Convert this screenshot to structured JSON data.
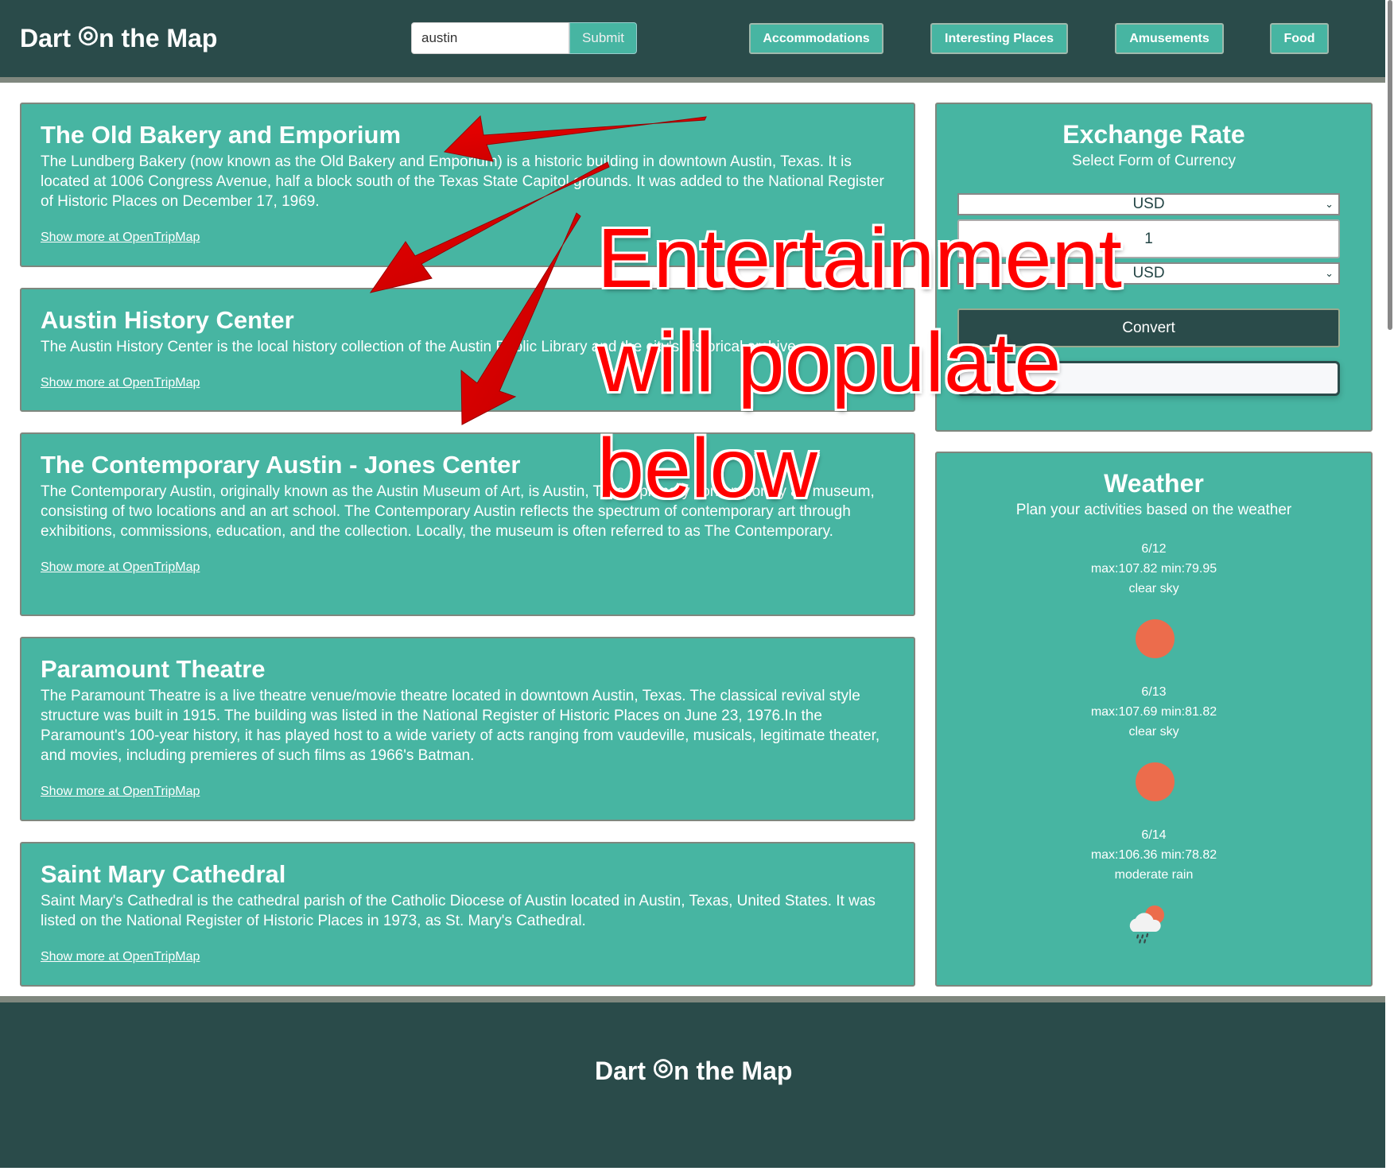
{
  "header": {
    "logo_pre": "Dart ",
    "logo_icon": "dart-target-icon",
    "logo_post": "n the Map",
    "search_value": "austin",
    "submit_label": "Submit",
    "nav": [
      "Accommodations",
      "Interesting Places",
      "Amusements",
      "Food"
    ]
  },
  "places": [
    {
      "title": "The Old Bakery and Emporium",
      "description": "The Lundberg Bakery (now known as the Old Bakery and Emporium) is a historic building in downtown Austin, Texas. It is located at 1006 Congress Avenue, half a block south of the Texas State Capitol grounds. It was added to the National Register of Historic Places on December 17, 1969.",
      "link": "Show more at OpenTripMap"
    },
    {
      "title": "Austin History Center",
      "description": "The Austin History Center is the local history collection of the Austin Public Library and the city's historical archive.",
      "link": "Show more at OpenTripMap"
    },
    {
      "title": "The Contemporary Austin - Jones Center",
      "description": "The Contemporary Austin, originally known as the Austin Museum of Art, is Austin, Texas' primary contemporary art museum, consisting of two locations and an art school. The Contemporary Austin reflects the spectrum of contemporary art through exhibitions, commissions, education, and the collection. Locally, the museum is often referred to as The Contemporary.",
      "link": "Show more at OpenTripMap"
    },
    {
      "title": "Paramount Theatre",
      "description": "The Paramount Theatre is a live theatre venue/movie theatre located in downtown Austin, Texas. The classical revival style structure was built in 1915. The building was listed in the National Register of Historic Places on June 23, 1976.In the Paramount's 100-year history, it has played host to a wide variety of acts ranging from vaudeville, musicals, legitimate theater, and movies, including premieres of such films as 1966's Batman.",
      "link": "Show more at OpenTripMap"
    },
    {
      "title": "Saint Mary Cathedral",
      "description": "Saint Mary's Cathedral is the cathedral parish of the Catholic Diocese of Austin located in Austin, Texas, United States. It was listed on the National Register of Historic Places in 1973, as St. Mary's Cathedral.",
      "link": "Show more at OpenTripMap"
    }
  ],
  "exchange": {
    "title": "Exchange Rate",
    "subtitle": "Select Form of Currency",
    "from_currency": "USD",
    "amount": "1",
    "to_currency": "USD",
    "convert_label": "Convert",
    "result": ""
  },
  "weather": {
    "title": "Weather",
    "subtitle": "Plan your activities based on the weather",
    "days": [
      {
        "date": "6/12",
        "temps": "max:107.82 min:79.95",
        "desc": "clear sky",
        "icon": "sun-icon"
      },
      {
        "date": "6/13",
        "temps": "max:107.69 min:81.82",
        "desc": "clear sky",
        "icon": "sun-icon"
      },
      {
        "date": "6/14",
        "temps": "max:106.36 min:78.82",
        "desc": "moderate rain",
        "icon": "rain-cloud-sun-icon"
      }
    ]
  },
  "footer": {
    "logo_pre": "Dart ",
    "logo_post": "n the Map"
  },
  "annotation": {
    "lines": [
      "Entertainment",
      "will populate",
      "below"
    ],
    "color": "#ff0000"
  },
  "colors": {
    "header": "#2a4b4a",
    "card": "#47b5a2",
    "accent_sun": "#ec6c4c"
  }
}
